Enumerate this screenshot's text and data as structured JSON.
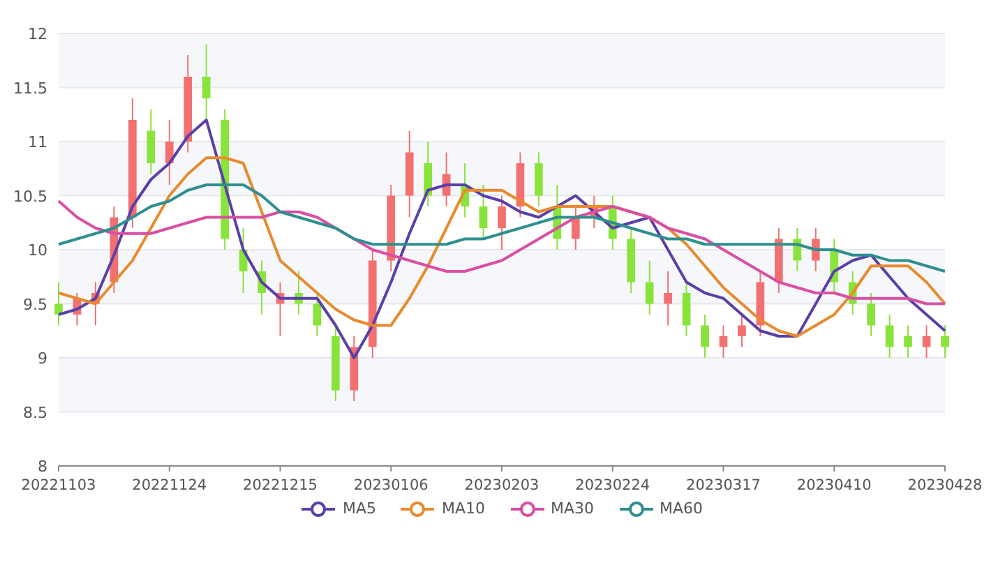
{
  "chart_data": {
    "type": "candlestick",
    "categories": [
      "20221103",
      null,
      null,
      null,
      null,
      null,
      "20221124",
      null,
      null,
      null,
      null,
      null,
      "20221215",
      null,
      null,
      null,
      null,
      null,
      "20230106",
      null,
      null,
      null,
      null,
      null,
      "20230203",
      null,
      null,
      null,
      null,
      null,
      "20230224",
      null,
      null,
      null,
      null,
      null,
      "20230317",
      null,
      null,
      null,
      null,
      null,
      "20230410",
      null,
      null,
      null,
      null,
      null,
      "20230428"
    ],
    "grid": true,
    "ylim": [
      8,
      12
    ],
    "yticks": [
      8,
      8.5,
      9,
      9.5,
      10,
      10.5,
      11,
      11.5,
      12
    ],
    "ohlc": [
      [
        9.5,
        9.7,
        9.3,
        9.4
      ],
      [
        9.4,
        9.6,
        9.3,
        9.55
      ],
      [
        9.5,
        9.7,
        9.3,
        9.6
      ],
      [
        9.7,
        10.4,
        9.6,
        10.3
      ],
      [
        10.3,
        11.4,
        10.2,
        11.2
      ],
      [
        11.1,
        11.3,
        10.7,
        10.8
      ],
      [
        10.8,
        11.2,
        10.6,
        11.0
      ],
      [
        11.0,
        11.8,
        10.9,
        11.6
      ],
      [
        11.6,
        11.9,
        11.2,
        11.4
      ],
      [
        11.2,
        11.3,
        10.0,
        10.1
      ],
      [
        10.0,
        10.2,
        9.6,
        9.8
      ],
      [
        9.8,
        9.9,
        9.4,
        9.6
      ],
      [
        9.5,
        9.7,
        9.2,
        9.6
      ],
      [
        9.6,
        9.8,
        9.4,
        9.5
      ],
      [
        9.5,
        9.6,
        9.2,
        9.3
      ],
      [
        9.2,
        9.3,
        8.6,
        8.7
      ],
      [
        8.7,
        9.2,
        8.6,
        9.1
      ],
      [
        9.1,
        10.0,
        9.0,
        9.9
      ],
      [
        9.9,
        10.6,
        9.8,
        10.5
      ],
      [
        10.5,
        11.1,
        10.3,
        10.9
      ],
      [
        10.8,
        11.0,
        10.4,
        10.5
      ],
      [
        10.5,
        10.9,
        10.4,
        10.7
      ],
      [
        10.6,
        10.8,
        10.3,
        10.4
      ],
      [
        10.4,
        10.6,
        10.1,
        10.2
      ],
      [
        10.2,
        10.5,
        10.0,
        10.4
      ],
      [
        10.4,
        10.9,
        10.3,
        10.8
      ],
      [
        10.8,
        10.9,
        10.4,
        10.5
      ],
      [
        10.4,
        10.6,
        10.0,
        10.1
      ],
      [
        10.1,
        10.4,
        10.0,
        10.3
      ],
      [
        10.3,
        10.5,
        10.2,
        10.4
      ],
      [
        10.4,
        10.5,
        10.0,
        10.1
      ],
      [
        10.1,
        10.2,
        9.6,
        9.7
      ],
      [
        9.7,
        9.9,
        9.4,
        9.5
      ],
      [
        9.5,
        9.8,
        9.3,
        9.6
      ],
      [
        9.6,
        9.7,
        9.2,
        9.3
      ],
      [
        9.3,
        9.4,
        9.0,
        9.1
      ],
      [
        9.1,
        9.3,
        9.0,
        9.2
      ],
      [
        9.2,
        9.4,
        9.1,
        9.3
      ],
      [
        9.3,
        9.8,
        9.2,
        9.7
      ],
      [
        9.7,
        10.2,
        9.6,
        10.1
      ],
      [
        10.1,
        10.2,
        9.8,
        9.9
      ],
      [
        9.9,
        10.2,
        9.8,
        10.1
      ],
      [
        10.0,
        10.1,
        9.6,
        9.7
      ],
      [
        9.7,
        9.8,
        9.4,
        9.5
      ],
      [
        9.5,
        9.6,
        9.2,
        9.3
      ],
      [
        9.3,
        9.4,
        9.0,
        9.1
      ],
      [
        9.2,
        9.3,
        9.0,
        9.1
      ],
      [
        9.1,
        9.3,
        9.0,
        9.2
      ],
      [
        9.2,
        9.3,
        9.0,
        9.1
      ]
    ],
    "series": [
      {
        "type": "line",
        "name": "MA5",
        "color": "#5b3fa8",
        "values": [
          9.4,
          9.45,
          9.55,
          9.95,
          10.4,
          10.65,
          10.8,
          11.05,
          11.2,
          10.6,
          10.0,
          9.7,
          9.55,
          9.55,
          9.55,
          9.3,
          9.0,
          9.3,
          9.7,
          10.15,
          10.55,
          10.6,
          10.6,
          10.5,
          10.45,
          10.35,
          10.3,
          10.4,
          10.5,
          10.35,
          10.2,
          10.25,
          10.3,
          10.0,
          9.7,
          9.6,
          9.55,
          9.4,
          9.25,
          9.2,
          9.2,
          9.5,
          9.8,
          9.9,
          9.95,
          9.75,
          9.55,
          9.4,
          9.25
        ]
      },
      {
        "type": "line",
        "name": "MA10",
        "color": "#e88a2e",
        "values": [
          9.6,
          9.55,
          9.5,
          9.7,
          9.9,
          10.2,
          10.5,
          10.7,
          10.85,
          10.85,
          10.8,
          10.35,
          9.9,
          9.75,
          9.6,
          9.45,
          9.35,
          9.3,
          9.3,
          9.55,
          9.85,
          10.2,
          10.55,
          10.55,
          10.55,
          10.45,
          10.35,
          10.4,
          10.4,
          10.4,
          10.4,
          10.35,
          10.3,
          10.2,
          10.05,
          9.85,
          9.65,
          9.5,
          9.35,
          9.25,
          9.2,
          9.3,
          9.4,
          9.6,
          9.85,
          9.85,
          9.85,
          9.7,
          9.5
        ]
      },
      {
        "type": "line",
        "name": "MA30",
        "color": "#d94fa3",
        "values": [
          10.45,
          10.3,
          10.2,
          10.15,
          10.15,
          10.15,
          10.2,
          10.25,
          10.3,
          10.3,
          10.3,
          10.3,
          10.35,
          10.35,
          10.3,
          10.2,
          10.1,
          10.0,
          9.95,
          9.9,
          9.85,
          9.8,
          9.8,
          9.85,
          9.9,
          10.0,
          10.1,
          10.2,
          10.3,
          10.35,
          10.4,
          10.35,
          10.3,
          10.2,
          10.15,
          10.1,
          10.0,
          9.9,
          9.8,
          9.7,
          9.65,
          9.6,
          9.6,
          9.55,
          9.55,
          9.55,
          9.55,
          9.5,
          9.5
        ]
      },
      {
        "type": "line",
        "name": "MA60",
        "color": "#2f8f8f",
        "values": [
          10.05,
          10.1,
          10.15,
          10.2,
          10.3,
          10.4,
          10.45,
          10.55,
          10.6,
          10.6,
          10.6,
          10.5,
          10.35,
          10.3,
          10.25,
          10.2,
          10.1,
          10.05,
          10.05,
          10.05,
          10.05,
          10.05,
          10.1,
          10.1,
          10.15,
          10.2,
          10.25,
          10.3,
          10.3,
          10.3,
          10.25,
          10.2,
          10.15,
          10.1,
          10.1,
          10.05,
          10.05,
          10.05,
          10.05,
          10.05,
          10.05,
          10.0,
          10.0,
          9.95,
          9.95,
          9.9,
          9.9,
          9.85,
          9.8
        ]
      }
    ]
  }
}
